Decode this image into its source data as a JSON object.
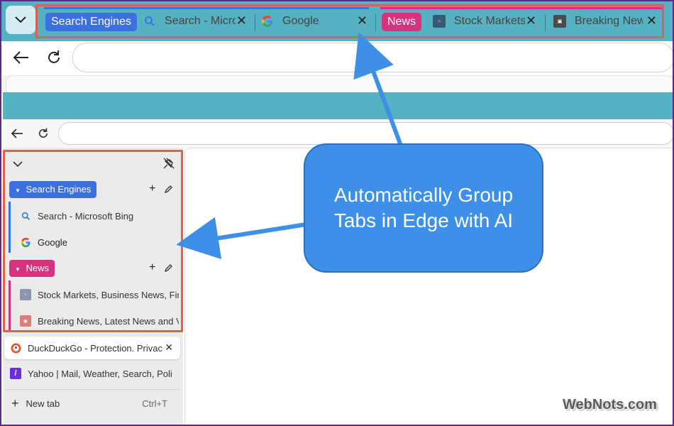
{
  "top_tabbar": {
    "groups": [
      {
        "label": "Search Engines",
        "color": "#3c6fe0"
      },
      {
        "label": "News",
        "color": "#d6337f"
      }
    ],
    "tabs": [
      {
        "label": "Search - Microsoft Bing",
        "icon": "search-icon"
      },
      {
        "label": "Google",
        "icon": "google-icon"
      },
      {
        "label": "Stock Markets, Business News",
        "icon": "cnbc-icon"
      },
      {
        "label": "Breaking News",
        "icon": "cnn-icon"
      }
    ],
    "close_glyph": "✕"
  },
  "sidebar": {
    "groups": [
      {
        "label": "Search Engines",
        "color": "#3c6fe0",
        "tabs": [
          {
            "label": "Search - Microsoft Bing"
          },
          {
            "label": "Google"
          }
        ]
      },
      {
        "label": "News",
        "color": "#d6337f",
        "tabs": [
          {
            "label": "Stock Markets, Business News, Financial"
          },
          {
            "label": "Breaking News, Latest News and Videos"
          }
        ]
      }
    ],
    "tabs": [
      {
        "label": "DuckDuckGo - Protection. Privacy"
      },
      {
        "label": "Yahoo | Mail, Weather, Search, Politics"
      }
    ],
    "new_tab": {
      "label": "New tab",
      "shortcut": "Ctrl+T"
    }
  },
  "callout": {
    "text": "Automatically Group Tabs in Edge with AI"
  },
  "watermark": "WebNots.com"
}
